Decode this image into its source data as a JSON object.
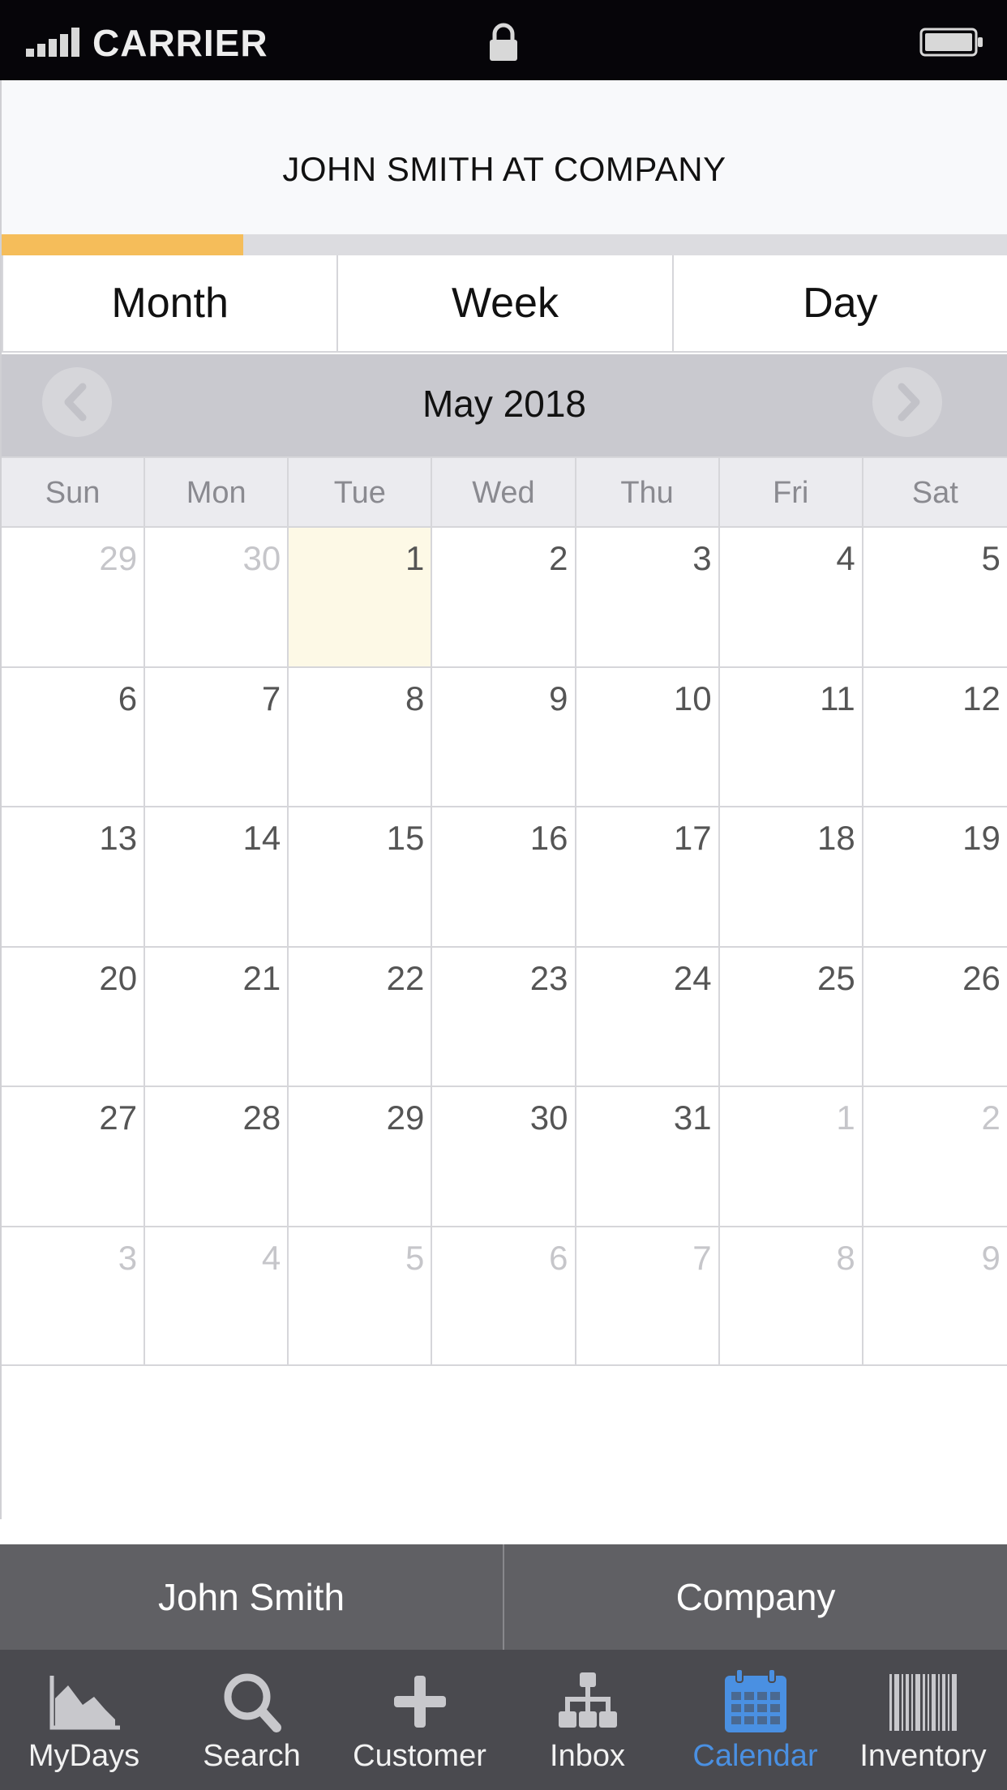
{
  "status_bar": {
    "carrier": "CARRIER",
    "signal_bars": 5,
    "lock_icon": "lock-icon",
    "battery_icon": "battery-icon"
  },
  "header": {
    "title": "JOHN SMITH AT COMPANY",
    "progress_fraction": 0.24,
    "progress_color": "#f5bd5a"
  },
  "view_tabs": [
    {
      "label": "Month"
    },
    {
      "label": "Week"
    },
    {
      "label": "Day"
    }
  ],
  "month_nav": {
    "label": "May 2018",
    "prev_icon": "chevron-left-icon",
    "next_icon": "chevron-right-icon"
  },
  "calendar": {
    "weekdays": [
      "Sun",
      "Mon",
      "Tue",
      "Wed",
      "Thu",
      "Fri",
      "Sat"
    ],
    "weeks": [
      [
        {
          "d": "29",
          "m": true
        },
        {
          "d": "30",
          "m": true
        },
        {
          "d": "1",
          "t": true
        },
        {
          "d": "2"
        },
        {
          "d": "3"
        },
        {
          "d": "4"
        },
        {
          "d": "5"
        }
      ],
      [
        {
          "d": "6"
        },
        {
          "d": "7"
        },
        {
          "d": "8"
        },
        {
          "d": "9"
        },
        {
          "d": "10"
        },
        {
          "d": "11"
        },
        {
          "d": "12"
        }
      ],
      [
        {
          "d": "13"
        },
        {
          "d": "14"
        },
        {
          "d": "15"
        },
        {
          "d": "16"
        },
        {
          "d": "17"
        },
        {
          "d": "18"
        },
        {
          "d": "19"
        }
      ],
      [
        {
          "d": "20"
        },
        {
          "d": "21"
        },
        {
          "d": "22"
        },
        {
          "d": "23"
        },
        {
          "d": "24"
        },
        {
          "d": "25"
        },
        {
          "d": "26"
        }
      ],
      [
        {
          "d": "27"
        },
        {
          "d": "28"
        },
        {
          "d": "29"
        },
        {
          "d": "30"
        },
        {
          "d": "31"
        },
        {
          "d": "1",
          "m": true
        },
        {
          "d": "2",
          "m": true
        }
      ],
      [
        {
          "d": "3",
          "m": true
        },
        {
          "d": "4",
          "m": true
        },
        {
          "d": "5",
          "m": true
        },
        {
          "d": "6",
          "m": true
        },
        {
          "d": "7",
          "m": true
        },
        {
          "d": "8",
          "m": true
        },
        {
          "d": "9",
          "m": true
        }
      ]
    ]
  },
  "context_bar": {
    "user": "John Smith",
    "company": "Company"
  },
  "tabbar": {
    "active_color": "#4a90e2",
    "items": [
      {
        "label": "MyDays",
        "icon": "area-chart-icon"
      },
      {
        "label": "Search",
        "icon": "search-icon"
      },
      {
        "label": "Customer",
        "icon": "plus-icon"
      },
      {
        "label": "Inbox",
        "icon": "org-chart-icon"
      },
      {
        "label": "Calendar",
        "icon": "calendar-icon",
        "active": true
      },
      {
        "label": "Inventory",
        "icon": "barcode-icon"
      }
    ]
  }
}
